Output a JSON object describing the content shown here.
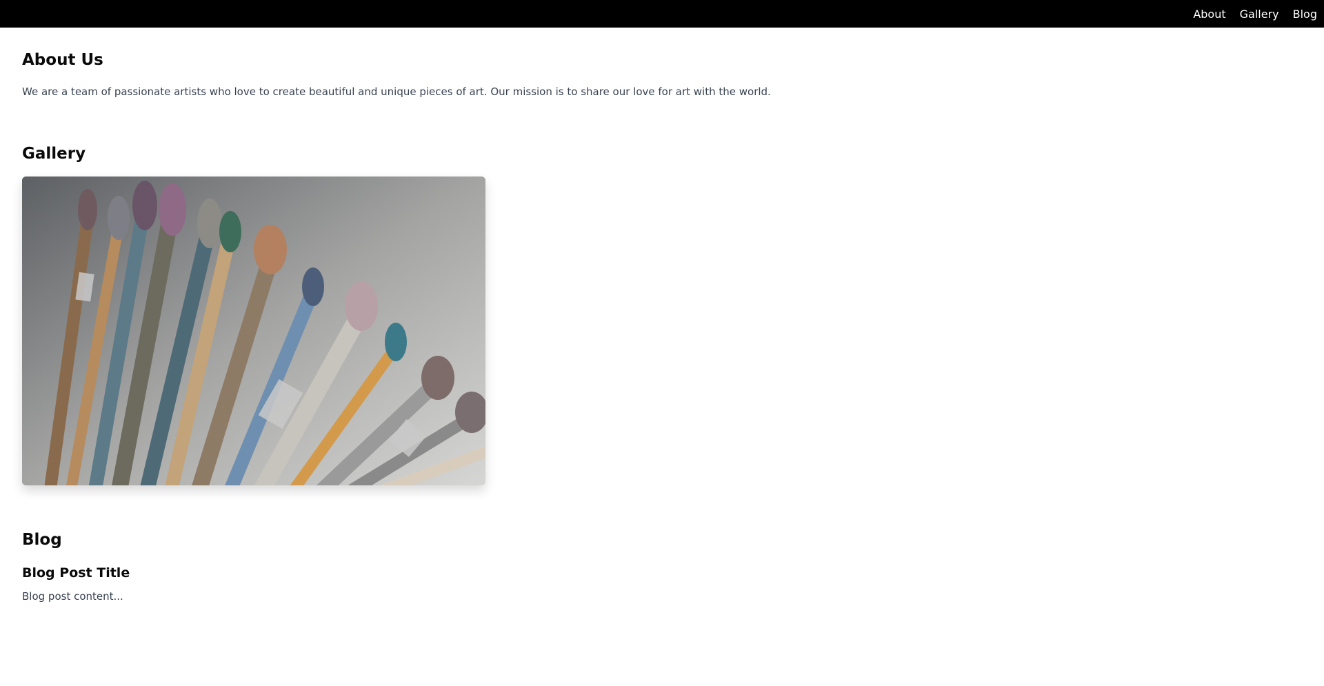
{
  "nav": {
    "items": [
      {
        "label": "About"
      },
      {
        "label": "Gallery"
      },
      {
        "label": "Blog"
      }
    ]
  },
  "about": {
    "title": "About Us",
    "text": "We are a team of passionate artists who love to create beautiful and unique pieces of art. Our mission is to share our love for art with the world."
  },
  "gallery": {
    "title": "Gallery",
    "image_subject": "paintbrushes"
  },
  "blog": {
    "title": "Blog",
    "post": {
      "title": "Blog Post Title",
      "content": "Blog post content..."
    }
  }
}
